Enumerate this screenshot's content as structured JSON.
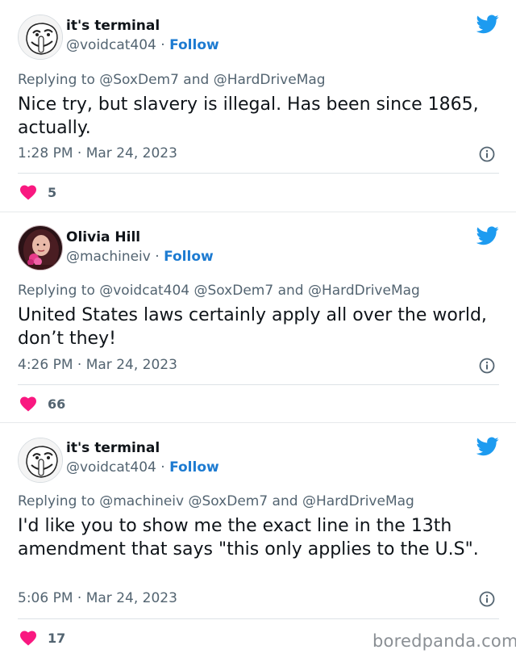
{
  "tweets": [
    {
      "name": "it's terminal",
      "handle": "@voidcat404",
      "dot": "·",
      "follow": "Follow",
      "replying_prefix": "Replying to",
      "replying_to": "@SoxDem7 and @HardDriveMag",
      "text": "Nice try, but slavery is illegal. Has been since 1865, actually.",
      "time": "1:28 PM",
      "date": "Mar 24, 2023",
      "likes": "5"
    },
    {
      "name": "Olivia Hill",
      "handle": "@machineiv",
      "dot": "·",
      "follow": "Follow",
      "replying_prefix": "Replying to",
      "replying_to": "@voidcat404 @SoxDem7 and @HardDriveMag",
      "text": "United States laws certainly apply all over the world, don’t they!",
      "time": "4:26 PM",
      "date": "Mar 24, 2023",
      "likes": "66"
    },
    {
      "name": "it's terminal",
      "handle": "@voidcat404",
      "dot": "·",
      "follow": "Follow",
      "replying_prefix": "Replying to",
      "replying_to": "@machineiv @SoxDem7 and @HardDriveMag",
      "text": "I'd like you to show me the exact line in the 13th amendment that says \"this only applies to the U.S\".",
      "time": "5:06 PM",
      "date": "Mar 24, 2023",
      "likes": "17"
    }
  ],
  "watermark": "boredpanda.com",
  "colors": {
    "accent": "#1d9bf0",
    "follow": "#1d7bd1",
    "heart": "#f91880",
    "muted": "#536471"
  },
  "icons": {
    "brand": "twitter-bird-icon",
    "info": "info-icon",
    "like": "heart-icon"
  }
}
